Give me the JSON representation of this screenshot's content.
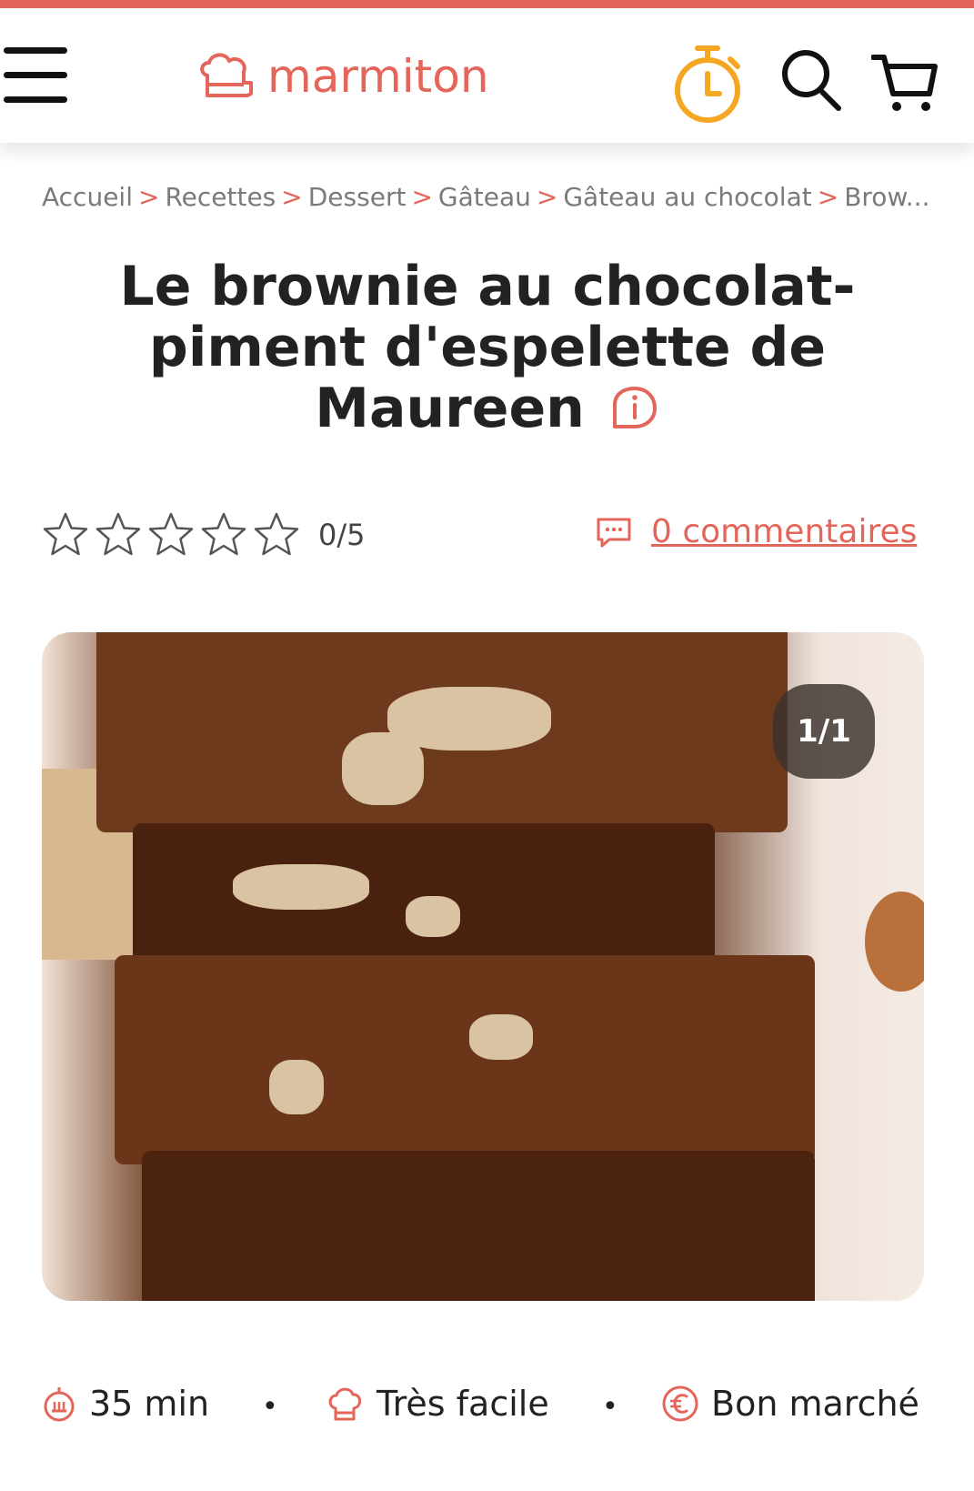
{
  "brand": {
    "name": "marmiton",
    "accent_color": "#e4655a",
    "timer_color": "#f5a623"
  },
  "header": {
    "icons": [
      "menu-icon",
      "chef-hat-logo-icon",
      "timer-icon",
      "search-icon",
      "cart-icon"
    ]
  },
  "breadcrumb": {
    "items": [
      "Accueil",
      "Recettes",
      "Dessert",
      "Gâteau",
      "Gâteau au chocolat",
      "Brow..."
    ]
  },
  "recipe": {
    "title_line1": "Le brownie au chocolat-",
    "title_line2": "piment d'espelette de",
    "title_line3": "Maureen",
    "rating": 0,
    "rating_max": 5,
    "rating_label": "0/5",
    "comments_label": "0 commentaires",
    "photo_counter": "1/1",
    "time": "35 min",
    "difficulty": "Très facile",
    "cost": "Bon marché",
    "separator": "•"
  }
}
